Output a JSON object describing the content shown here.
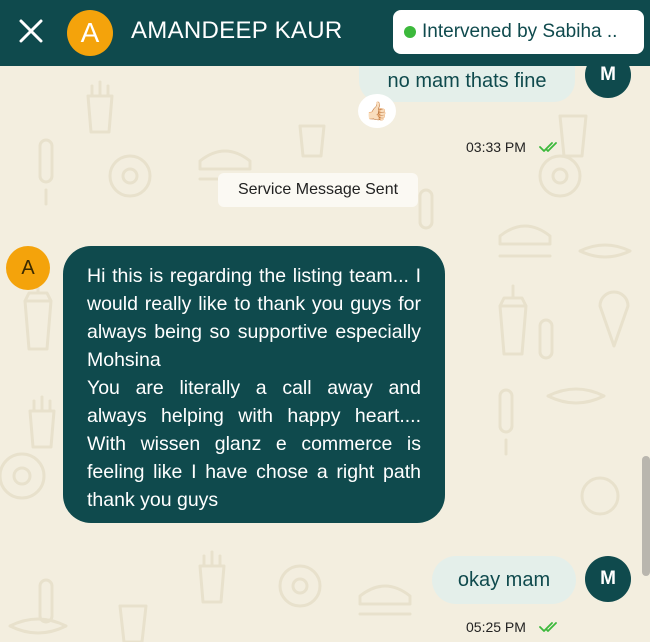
{
  "header": {
    "close_icon": "close-icon",
    "avatar_initial": "A",
    "contact_name": "AMANDEEP KAUR",
    "status_badge": "Intervened by Sabiha ..",
    "status_color": "#3cb93c"
  },
  "colors": {
    "header_bg": "#0f4a4d",
    "chat_bg": "#f3eedf",
    "incoming_bubble": "#0f4a4d",
    "outgoing_bubble": "#e4efea",
    "avatar_accent": "#f4a30b",
    "read_tick": "#3cb93c"
  },
  "messages": [
    {
      "direction": "outgoing",
      "text": "no mam thats fine",
      "avatar_initial": "M",
      "reaction": "👍🏻",
      "time": "03:33 PM",
      "status_icon": "double-check-icon"
    },
    {
      "type": "system",
      "text": "Service Message Sent"
    },
    {
      "direction": "incoming",
      "avatar_initial": "A",
      "paragraphs": [
        "Hi this is regarding the listing team... I would really like to thank you guys for always being so supportive especially Mohsina",
        "You are literally a call away and always helping with happy heart.... With wissen glanz e commerce is feeling like I have chose a right path thank you guys"
      ]
    },
    {
      "direction": "outgoing",
      "text": "okay mam",
      "avatar_initial": "M",
      "time": "05:25 PM",
      "status_icon": "double-check-icon"
    }
  ]
}
